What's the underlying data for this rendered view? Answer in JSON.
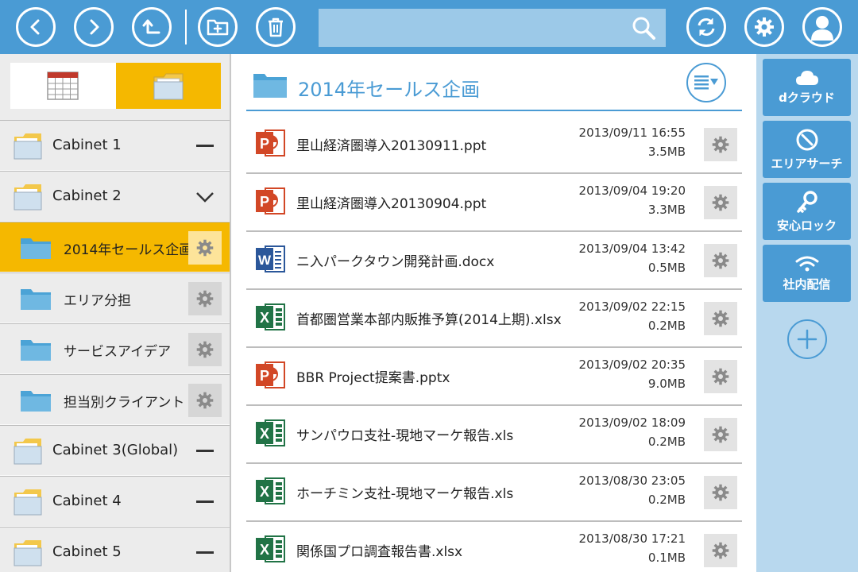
{
  "search": {
    "placeholder": ""
  },
  "view_toggle": {
    "calendar_icon": "calendar-icon",
    "folder_icon": "folder-icon"
  },
  "sidebar": {
    "items": [
      {
        "type": "cabinet",
        "label": "Cabinet 1",
        "toggle": "collapse"
      },
      {
        "type": "cabinet",
        "label": "Cabinet 2",
        "toggle": "expanded"
      },
      {
        "type": "folder",
        "label": "2014年セールス企画",
        "active": true
      },
      {
        "type": "folder",
        "label": "エリア分担"
      },
      {
        "type": "folder",
        "label": "サービスアイデア"
      },
      {
        "type": "folder",
        "label": "担当別クライアント"
      },
      {
        "type": "cabinet",
        "label": "Cabinet 3(Global)",
        "toggle": "collapse"
      },
      {
        "type": "cabinet",
        "label": "Cabinet 4",
        "toggle": "collapse"
      },
      {
        "type": "cabinet",
        "label": "Cabinet 5",
        "toggle": "collapse"
      }
    ]
  },
  "main": {
    "title": "2014年セールス企画",
    "files": [
      {
        "type": "ppt",
        "name": "里山経済圏導入20130911.ppt",
        "date": "2013/09/11 16:55",
        "size": "3.5MB"
      },
      {
        "type": "ppt",
        "name": "里山経済圏導入20130904.ppt",
        "date": "2013/09/04 19:20",
        "size": "3.3MB"
      },
      {
        "type": "word",
        "name": "ニ入パークタウン開発計画.docx",
        "date": "2013/09/04 13:42",
        "size": "0.5MB"
      },
      {
        "type": "excel",
        "name": "首都圏営業本部内販推予算(2014上期).xlsx",
        "date": "2013/09/02 22:15",
        "size": "0.2MB"
      },
      {
        "type": "ppt",
        "name": "BBR Project提案書.pptx",
        "date": "2013/09/02 20:35",
        "size": "9.0MB"
      },
      {
        "type": "excel",
        "name": "サンパウロ支社-現地マーケ報告.xls",
        "date": "2013/09/02 18:09",
        "size": "0.2MB"
      },
      {
        "type": "excel",
        "name": "ホーチミン支社-現地マーケ報告.xls",
        "date": "2013/08/30 23:05",
        "size": "0.2MB"
      },
      {
        "type": "excel",
        "name": "関係国プロ調査報告書.xlsx",
        "date": "2013/08/30 17:21",
        "size": "0.1MB"
      }
    ]
  },
  "services": [
    {
      "label": "dクラウド",
      "icon": "cloud-icon"
    },
    {
      "label": "エリアサーチ",
      "icon": "compass-icon"
    },
    {
      "label": "安心ロック",
      "icon": "key-icon"
    },
    {
      "label": "社内配信",
      "icon": "wifi-icon"
    }
  ],
  "colors": {
    "accent": "#4a9bd4",
    "active": "#f5b800",
    "ppt": "#d24726",
    "word": "#2b579a",
    "excel": "#217346"
  }
}
